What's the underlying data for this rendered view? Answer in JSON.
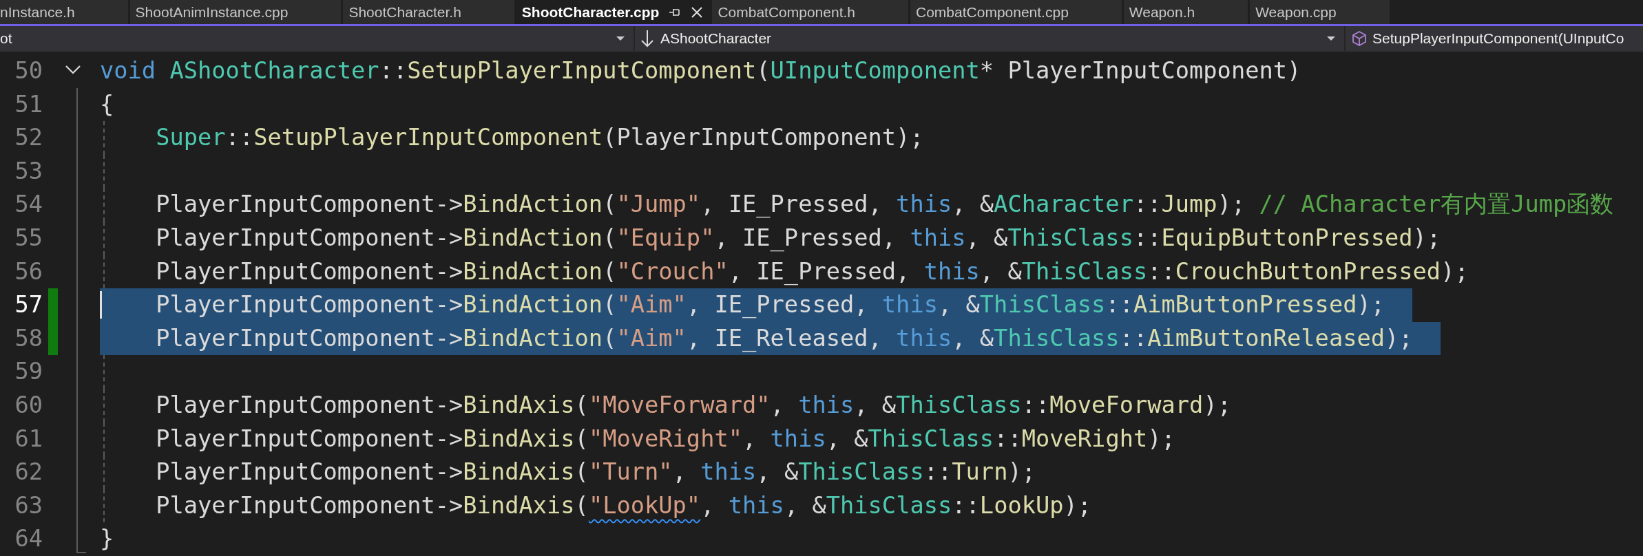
{
  "tabs": [
    {
      "label": "nInstance.h",
      "selected": false
    },
    {
      "label": "ShootAnimInstance.cpp",
      "selected": false
    },
    {
      "label": "ShootCharacter.h",
      "selected": false
    },
    {
      "label": "ShootCharacter.cpp",
      "selected": true
    },
    {
      "label": "CombatComponent.h",
      "selected": false
    },
    {
      "label": "CombatComponent.cpp",
      "selected": false
    },
    {
      "label": "Weapon.h",
      "selected": false
    },
    {
      "label": "Weapon.cpp",
      "selected": false
    }
  ],
  "navigation": {
    "project": "ot",
    "class": "AShootCharacter",
    "member": "SetupPlayerInputComponent(UInputCo"
  },
  "editor": {
    "lines": [
      {
        "number": "50",
        "selected": false,
        "changed": false,
        "current": false,
        "fold": {
          "expanded": true
        },
        "tokens": [
          {
            "kind": "keyword",
            "text": "void "
          },
          {
            "kind": "type",
            "text": "AShootCharacter"
          },
          {
            "kind": "plain",
            "text": "::"
          },
          {
            "kind": "func",
            "text": "SetupPlayerInputComponent"
          },
          {
            "kind": "plain",
            "text": "("
          },
          {
            "kind": "type",
            "text": "UInputComponent"
          },
          {
            "kind": "plain",
            "text": "* PlayerInputComponent)"
          }
        ]
      },
      {
        "number": "51",
        "selected": false,
        "changed": false,
        "current": false,
        "tokens": [
          {
            "kind": "plain",
            "text": "{"
          }
        ],
        "children": [
          {
            "number": "52",
            "selected": false,
            "changed": false,
            "current": false,
            "tokens": [
              {
                "kind": "type",
                "text": "Super"
              },
              {
                "kind": "plain",
                "text": "::"
              },
              {
                "kind": "func",
                "text": "SetupPlayerInputComponent"
              },
              {
                "kind": "plain",
                "text": "(PlayerInputComponent);"
              }
            ]
          },
          {
            "number": "53",
            "selected": false,
            "changed": false,
            "current": false
          },
          {
            "number": "54",
            "selected": false,
            "changed": false,
            "current": false,
            "tokens": [
              {
                "kind": "plain",
                "text": "PlayerInputComponent->"
              },
              {
                "kind": "func",
                "text": "BindAction"
              },
              {
                "kind": "plain",
                "text": "("
              },
              {
                "kind": "string",
                "text": "\"Jump\""
              },
              {
                "kind": "plain",
                "text": ", IE_Pressed, "
              },
              {
                "kind": "keyword",
                "text": "this"
              },
              {
                "kind": "plain",
                "text": ", &"
              },
              {
                "kind": "type",
                "text": "ACharacter"
              },
              {
                "kind": "plain",
                "text": "::"
              },
              {
                "kind": "func",
                "text": "Jump"
              },
              {
                "kind": "plain",
                "text": "); "
              },
              {
                "kind": "comment",
                "text": "// ACharacter有内置Jump函数"
              }
            ]
          },
          {
            "number": "55",
            "selected": false,
            "changed": false,
            "current": false,
            "tokens": [
              {
                "kind": "plain",
                "text": "PlayerInputComponent->"
              },
              {
                "kind": "func",
                "text": "BindAction"
              },
              {
                "kind": "plain",
                "text": "("
              },
              {
                "kind": "string",
                "text": "\"Equip\""
              },
              {
                "kind": "plain",
                "text": ", IE_Pressed, "
              },
              {
                "kind": "keyword",
                "text": "this"
              },
              {
                "kind": "plain",
                "text": ", &"
              },
              {
                "kind": "type",
                "text": "ThisClass"
              },
              {
                "kind": "plain",
                "text": "::"
              },
              {
                "kind": "func",
                "text": "EquipButtonPressed"
              },
              {
                "kind": "plain",
                "text": ");"
              }
            ]
          },
          {
            "number": "56",
            "selected": false,
            "changed": false,
            "current": false,
            "tokens": [
              {
                "kind": "plain",
                "text": "PlayerInputComponent->"
              },
              {
                "kind": "func",
                "text": "BindAction"
              },
              {
                "kind": "plain",
                "text": "("
              },
              {
                "kind": "string",
                "text": "\"Crouch\""
              },
              {
                "kind": "plain",
                "text": ", IE_Pressed, "
              },
              {
                "kind": "keyword",
                "text": "this"
              },
              {
                "kind": "plain",
                "text": ", &"
              },
              {
                "kind": "type",
                "text": "ThisClass"
              },
              {
                "kind": "plain",
                "text": "::"
              },
              {
                "kind": "func",
                "text": "CrouchButtonPressed"
              },
              {
                "kind": "plain",
                "text": ");"
              }
            ]
          },
          {
            "number": "57",
            "selected": true,
            "changed": true,
            "current": true,
            "tokens": [
              {
                "kind": "plain",
                "text": "PlayerInputComponent->"
              },
              {
                "kind": "func",
                "text": "BindAction"
              },
              {
                "kind": "plain",
                "text": "("
              },
              {
                "kind": "string",
                "text": "\"Aim\""
              },
              {
                "kind": "plain",
                "text": ", IE_Pressed, "
              },
              {
                "kind": "keyword",
                "text": "this"
              },
              {
                "kind": "plain",
                "text": ", &"
              },
              {
                "kind": "type",
                "text": "ThisClass"
              },
              {
                "kind": "plain",
                "text": "::"
              },
              {
                "kind": "func",
                "text": "AimButtonPressed"
              },
              {
                "kind": "plain",
                "text": ");"
              }
            ]
          },
          {
            "number": "58",
            "selected": true,
            "changed": true,
            "current": false,
            "tokens": [
              {
                "kind": "plain",
                "text": "PlayerInputComponent->"
              },
              {
                "kind": "func",
                "text": "BindAction"
              },
              {
                "kind": "plain",
                "text": "("
              },
              {
                "kind": "string",
                "text": "\"Aim\""
              },
              {
                "kind": "plain",
                "text": ", IE_Released, "
              },
              {
                "kind": "keyword",
                "text": "this"
              },
              {
                "kind": "plain",
                "text": ", &"
              },
              {
                "kind": "type",
                "text": "ThisClass"
              },
              {
                "kind": "plain",
                "text": "::"
              },
              {
                "kind": "func",
                "text": "AimButtonReleased"
              },
              {
                "kind": "plain",
                "text": ");"
              }
            ]
          },
          {
            "number": "59",
            "selected": false,
            "changed": false,
            "current": false
          },
          {
            "number": "60",
            "selected": false,
            "changed": false,
            "current": false,
            "tokens": [
              {
                "kind": "plain",
                "text": "PlayerInputComponent->"
              },
              {
                "kind": "func",
                "text": "BindAxis"
              },
              {
                "kind": "plain",
                "text": "("
              },
              {
                "kind": "string",
                "text": "\"MoveForward\""
              },
              {
                "kind": "plain",
                "text": ", "
              },
              {
                "kind": "keyword",
                "text": "this"
              },
              {
                "kind": "plain",
                "text": ", &"
              },
              {
                "kind": "type",
                "text": "ThisClass"
              },
              {
                "kind": "plain",
                "text": "::"
              },
              {
                "kind": "func",
                "text": "MoveForward"
              },
              {
                "kind": "plain",
                "text": ");"
              }
            ]
          },
          {
            "number": "61",
            "selected": false,
            "changed": false,
            "current": false,
            "tokens": [
              {
                "kind": "plain",
                "text": "PlayerInputComponent->"
              },
              {
                "kind": "func",
                "text": "BindAxis"
              },
              {
                "kind": "plain",
                "text": "("
              },
              {
                "kind": "string",
                "text": "\"MoveRight\""
              },
              {
                "kind": "plain",
                "text": ", "
              },
              {
                "kind": "keyword",
                "text": "this"
              },
              {
                "kind": "plain",
                "text": ", &"
              },
              {
                "kind": "type",
                "text": "ThisClass"
              },
              {
                "kind": "plain",
                "text": "::"
              },
              {
                "kind": "func",
                "text": "MoveRight"
              },
              {
                "kind": "plain",
                "text": ");"
              }
            ]
          },
          {
            "number": "62",
            "selected": false,
            "changed": false,
            "current": false,
            "tokens": [
              {
                "kind": "plain",
                "text": "PlayerInputComponent->"
              },
              {
                "kind": "func",
                "text": "BindAxis"
              },
              {
                "kind": "plain",
                "text": "("
              },
              {
                "kind": "string",
                "text": "\"Turn\""
              },
              {
                "kind": "plain",
                "text": ", "
              },
              {
                "kind": "keyword",
                "text": "this"
              },
              {
                "kind": "plain",
                "text": ", &"
              },
              {
                "kind": "type",
                "text": "ThisClass"
              },
              {
                "kind": "plain",
                "text": "::"
              },
              {
                "kind": "func",
                "text": "Turn"
              },
              {
                "kind": "plain",
                "text": ");"
              }
            ]
          },
          {
            "number": "63",
            "selected": false,
            "changed": false,
            "current": false,
            "tokens": [
              {
                "kind": "plain",
                "text": "PlayerInputComponent->"
              },
              {
                "kind": "func",
                "text": "BindAxis"
              },
              {
                "kind": "plain",
                "text": "("
              },
              {
                "kind": "squiggled-string",
                "text": "\"LookUp\""
              },
              {
                "kind": "plain",
                "text": ", "
              },
              {
                "kind": "keyword",
                "text": "this"
              },
              {
                "kind": "plain",
                "text": ", &"
              },
              {
                "kind": "type",
                "text": "ThisClass"
              },
              {
                "kind": "plain",
                "text": "::"
              },
              {
                "kind": "func",
                "text": "LookUp"
              },
              {
                "kind": "plain",
                "text": ");"
              }
            ]
          }
        ]
      },
      {
        "number": "64",
        "selected": false,
        "changed": false,
        "current": false,
        "tokens": [
          {
            "kind": "plain",
            "text": "}"
          }
        ]
      }
    ]
  }
}
